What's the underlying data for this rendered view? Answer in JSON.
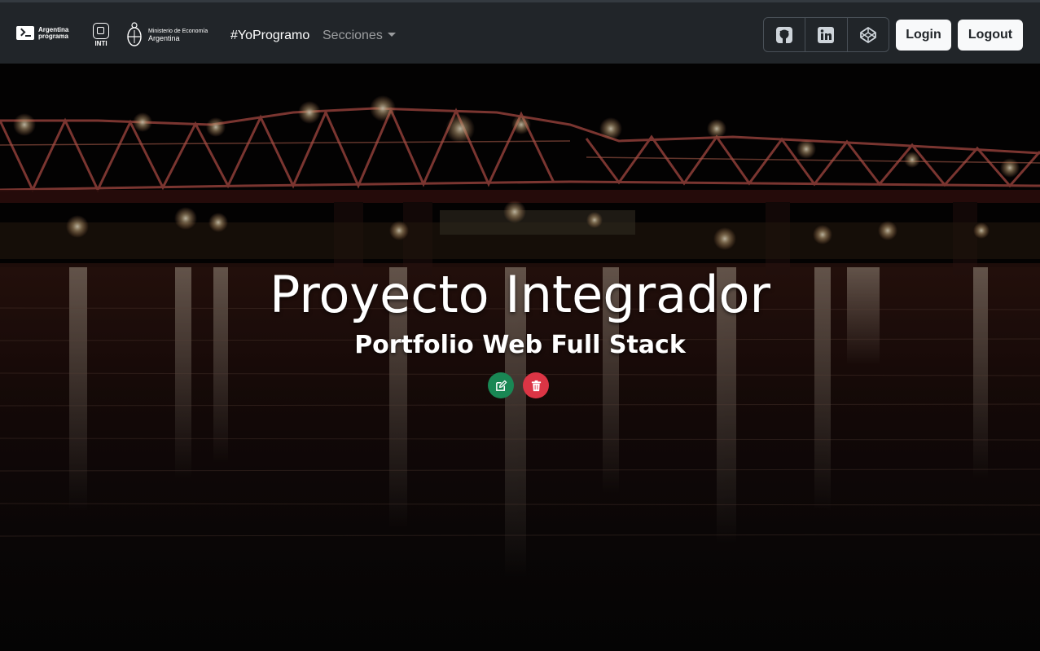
{
  "navbar": {
    "brand_argentina_programa": "Argentina programa",
    "brand_inti": "INTI",
    "brand_ministerio_line1": "Ministerio de Economía",
    "brand_ministerio_line2": "Argentina",
    "links": {
      "yoprogramo": "#YoProgramo",
      "secciones": "Secciones"
    },
    "social": [
      "github-icon",
      "linkedin-icon",
      "codepen-icon"
    ],
    "login_label": "Login",
    "logout_label": "Logout"
  },
  "hero": {
    "title": "Proyecto Integrador",
    "subtitle": "Portfolio Web Full Stack",
    "edit_icon": "edit-icon",
    "delete_icon": "trash-icon"
  },
  "colors": {
    "navbar_bg": "#212529",
    "edit_button": "#198754",
    "delete_button": "#dc3545",
    "light_button": "#f8f9fa"
  }
}
